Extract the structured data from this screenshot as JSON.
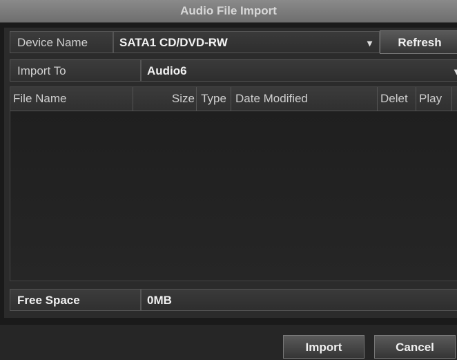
{
  "window": {
    "title": "Audio File Import"
  },
  "device": {
    "label": "Device Name",
    "value": "SATA1 CD/DVD-RW",
    "refresh_label": "Refresh"
  },
  "import_to": {
    "label": "Import To",
    "value": "Audio6"
  },
  "table": {
    "columns": [
      "File Name",
      "Size",
      "Type",
      "Date Modified",
      "Delet",
      "Play"
    ],
    "rows": []
  },
  "free_space": {
    "label": "Free Space",
    "value": "0MB"
  },
  "actions": {
    "import_label": "Import",
    "cancel_label": "Cancel"
  }
}
